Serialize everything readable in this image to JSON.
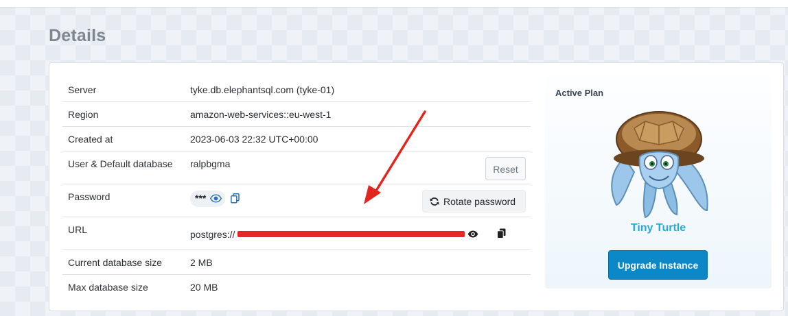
{
  "page": {
    "title": "Details"
  },
  "details": {
    "rows": [
      {
        "label": "Server",
        "value": "tyke.db.elephantsql.com (tyke-01)"
      },
      {
        "label": "Region",
        "value": "amazon-web-services::eu-west-1"
      },
      {
        "label": "Created at",
        "value": "2023-06-03 22:32 UTC+00:00"
      },
      {
        "label": "User & Default database",
        "value": "ralpbgma"
      },
      {
        "label": "Password",
        "value": "***"
      },
      {
        "label": "URL",
        "value": "postgres://"
      },
      {
        "label": "Current database size",
        "value": "2 MB"
      },
      {
        "label": "Max database size",
        "value": "20 MB"
      }
    ],
    "reset_label": "Reset",
    "rotate_label": "Rotate password"
  },
  "plan": {
    "heading": "Active Plan",
    "name": "Tiny Turtle",
    "upgrade_label": "Upgrade Instance",
    "mascot": "turtle-mascot-illustration"
  },
  "icons": [
    "eye-icon",
    "copy-icon",
    "refresh-icon",
    "clipboard-icon"
  ],
  "colors": {
    "accent": "#0c88c9",
    "plan_name": "#23a9dc",
    "annotation_arrow": "#e2261f",
    "redaction": "#e8262a"
  }
}
